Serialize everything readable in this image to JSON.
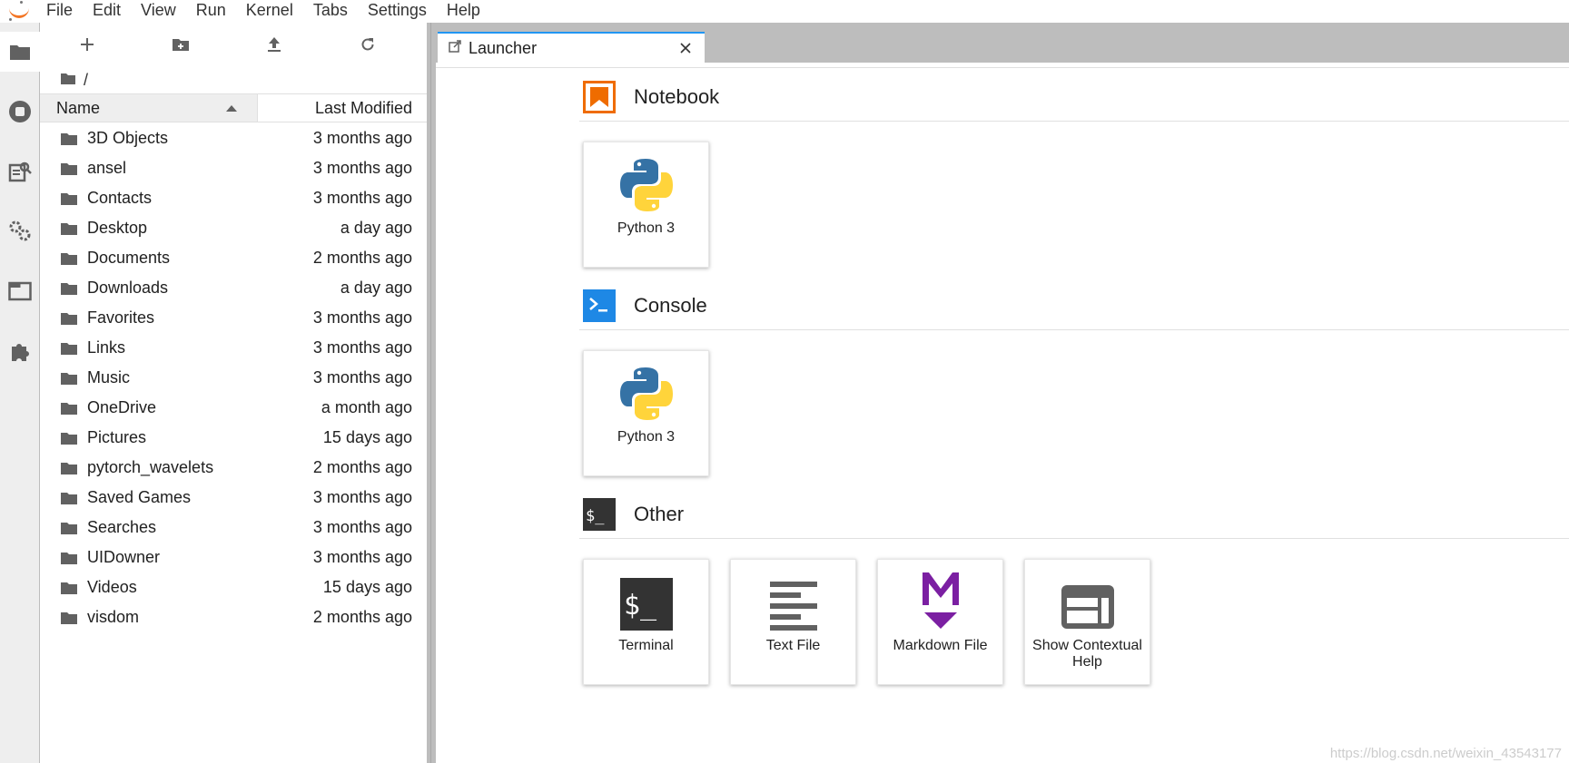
{
  "menubar": {
    "items": [
      "File",
      "Edit",
      "View",
      "Run",
      "Kernel",
      "Tabs",
      "Settings",
      "Help"
    ]
  },
  "activity_bar": {
    "icons": [
      "folder-icon",
      "running-icon",
      "commands-icon",
      "property-inspector-icon",
      "tabs-icon",
      "extension-icon"
    ]
  },
  "file_browser": {
    "toolbar": [
      "new-launcher-icon",
      "new-folder-icon",
      "upload-icon",
      "refresh-icon"
    ],
    "breadcrumb": "/",
    "header": {
      "name": "Name",
      "modified": "Last Modified"
    },
    "rows": [
      {
        "name": "3D Objects",
        "modified": "3 months ago"
      },
      {
        "name": "ansel",
        "modified": "3 months ago"
      },
      {
        "name": "Contacts",
        "modified": "3 months ago"
      },
      {
        "name": "Desktop",
        "modified": "a day ago"
      },
      {
        "name": "Documents",
        "modified": "2 months ago"
      },
      {
        "name": "Downloads",
        "modified": "a day ago"
      },
      {
        "name": "Favorites",
        "modified": "3 months ago"
      },
      {
        "name": "Links",
        "modified": "3 months ago"
      },
      {
        "name": "Music",
        "modified": "3 months ago"
      },
      {
        "name": "OneDrive",
        "modified": "a month ago"
      },
      {
        "name": "Pictures",
        "modified": "15 days ago"
      },
      {
        "name": "pytorch_wavelets",
        "modified": "2 months ago"
      },
      {
        "name": "Saved Games",
        "modified": "3 months ago"
      },
      {
        "name": "Searches",
        "modified": "3 months ago"
      },
      {
        "name": "UIDowner",
        "modified": "3 months ago"
      },
      {
        "name": "Videos",
        "modified": "15 days ago"
      },
      {
        "name": "visdom",
        "modified": "2 months ago"
      }
    ]
  },
  "tab": {
    "label": "Launcher"
  },
  "launcher": {
    "notebook": {
      "title": "Notebook",
      "cards": [
        "Python 3"
      ]
    },
    "console": {
      "title": "Console",
      "cards": [
        "Python 3"
      ]
    },
    "other": {
      "title": "Other",
      "cards": [
        "Terminal",
        "Text File",
        "Markdown File",
        "Show Contextual Help"
      ]
    }
  },
  "watermark": "https://blog.csdn.net/weixin_43543177",
  "colors": {
    "accent": "#2196f3",
    "notebook": "#ef6c00",
    "console": "#0288d1",
    "markdown": "#7b1fa2",
    "terminal": "#333333"
  }
}
